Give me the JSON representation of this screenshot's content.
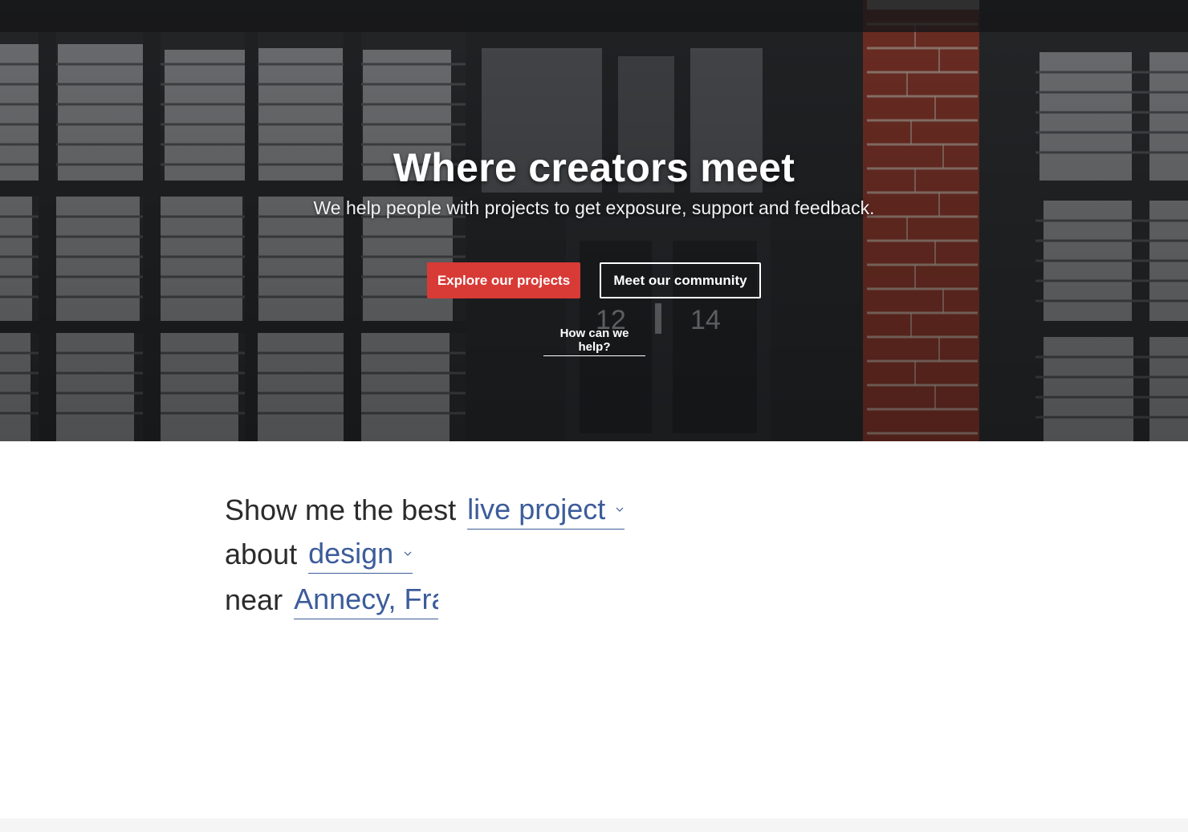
{
  "hero": {
    "title": "Where creators meet",
    "subtitle": "We help people with projects to get exposure, support and feedback.",
    "primary_button": "Explore our projects",
    "secondary_button": "Meet our community",
    "help_link": "How can we help?",
    "door_numbers": [
      "12",
      "14"
    ],
    "colors": {
      "primary_button": "#d83a36",
      "text": "#ffffff"
    }
  },
  "filter": {
    "line1_label": "Show me the best",
    "project_type": "live project",
    "line2_label": "about",
    "category": "design",
    "line3_label": "near",
    "location_value": "Annecy, Fran",
    "colors": {
      "label": "#2b2b2b",
      "value": "#3c5c9a"
    }
  }
}
